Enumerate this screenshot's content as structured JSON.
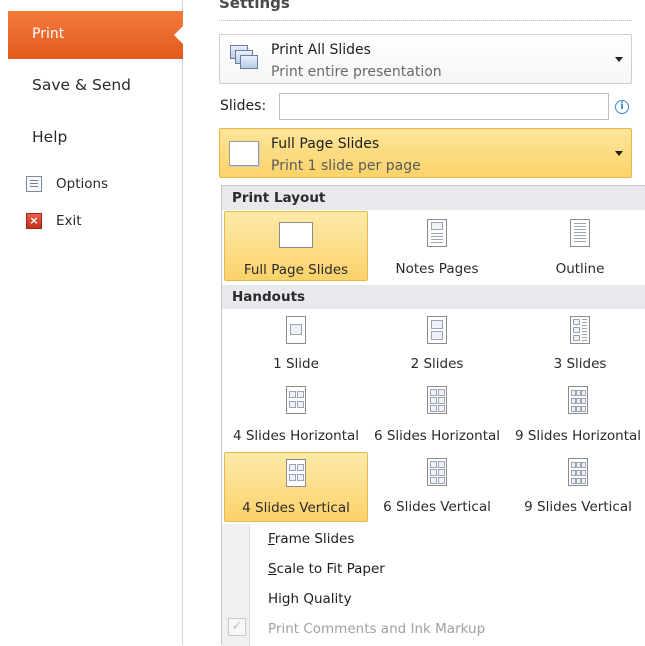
{
  "nav": {
    "print": "Print",
    "save_send": "Save & Send",
    "help": "Help",
    "options": "Options",
    "exit": "Exit"
  },
  "settings": {
    "title": "Settings",
    "range": {
      "title": "Print All Slides",
      "subtitle": "Print entire presentation"
    },
    "slides_label": "Slides:",
    "slides_value": "",
    "layout": {
      "title": "Full Page Slides",
      "subtitle": "Print 1 slide per page"
    }
  },
  "menu": {
    "print_layout_header": "Print Layout",
    "print_layout": [
      {
        "label": "Full Page Slides",
        "selected": true
      },
      {
        "label": "Notes Pages",
        "selected": false
      },
      {
        "label": "Outline",
        "selected": false
      }
    ],
    "handouts_header": "Handouts",
    "handouts": [
      {
        "label": "1 Slide"
      },
      {
        "label": "2 Slides"
      },
      {
        "label": "3 Slides"
      },
      {
        "label": "4 Slides Horizontal"
      },
      {
        "label": "6 Slides Horizontal"
      },
      {
        "label": "9 Slides Horizontal"
      },
      {
        "label": "4 Slides Vertical",
        "selected": true
      },
      {
        "label": "6 Slides Vertical"
      },
      {
        "label": "9 Slides Vertical"
      }
    ],
    "options": {
      "frame_first": "F",
      "frame_rest": "rame Slides",
      "scale_first": "S",
      "scale_rest": "cale to Fit Paper",
      "high_quality": "High Quality",
      "comments": "Print Comments and Ink Markup",
      "comments_checked": true
    }
  },
  "colors": {
    "accent_orange": "#e8621f",
    "selection_gold": "#fbd26b",
    "header_gray": "#e7e9ec"
  }
}
